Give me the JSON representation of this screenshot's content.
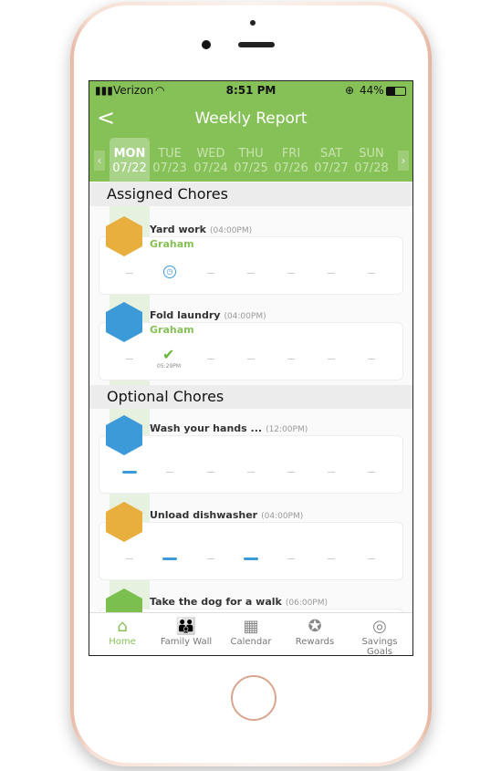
{
  "status": {
    "carrier": "Verizon",
    "time": "8:51 PM",
    "battery": "44%"
  },
  "header": {
    "title": "Weekly Report"
  },
  "days": [
    {
      "day": "MON",
      "date": "07/22"
    },
    {
      "day": "TUE",
      "date": "07/23"
    },
    {
      "day": "WED",
      "date": "07/24"
    },
    {
      "day": "THU",
      "date": "07/25"
    },
    {
      "day": "FRI",
      "date": "07/26"
    },
    {
      "day": "SAT",
      "date": "07/27"
    },
    {
      "day": "SUN",
      "date": "07/28"
    }
  ],
  "selected_day": "MON",
  "sections": {
    "assigned": "Assigned Chores",
    "optional": "Optional Chores"
  },
  "chores": [
    {
      "name": "Yard work",
      "time": "(04:00PM)",
      "assignee": "Graham",
      "icon": "lawn-mower-icon",
      "color": "#e8ae3e",
      "statuses": [
        "none",
        "pending",
        "none",
        "none",
        "none",
        "none",
        "none"
      ]
    },
    {
      "name": "Fold laundry",
      "time": "(04:00PM)",
      "assignee": "Graham",
      "icon": "laundry-icon",
      "color": "#3d9ad9",
      "statuses": [
        "none",
        "done",
        "none",
        "none",
        "none",
        "none",
        "none"
      ],
      "done_time": "05:29PM"
    },
    {
      "name": "Wash your hands ...",
      "time": "(12:00PM)",
      "icon": "hand-wash-icon",
      "color": "#3d9ad9",
      "statuses": [
        "scheduled",
        "none",
        "none",
        "none",
        "none",
        "none",
        "none"
      ]
    },
    {
      "name": "Unload dishwasher",
      "time": "(04:00PM)",
      "icon": "dishwasher-icon",
      "color": "#e8ae3e",
      "statuses": [
        "none",
        "scheduled",
        "none",
        "scheduled",
        "none",
        "none",
        "none"
      ]
    },
    {
      "name": "Take the dog for a walk",
      "time": "(06:00PM)",
      "icon": "dog-icon",
      "color": "#7bbf4e"
    }
  ],
  "tabs": [
    {
      "label": "Home",
      "icon": "home-icon"
    },
    {
      "label": "Family Wall",
      "icon": "family-icon"
    },
    {
      "label": "Calendar",
      "icon": "calendar-icon"
    },
    {
      "label": "Rewards",
      "icon": "medal-icon"
    },
    {
      "label": "Savings Goals",
      "icon": "target-icon"
    }
  ]
}
